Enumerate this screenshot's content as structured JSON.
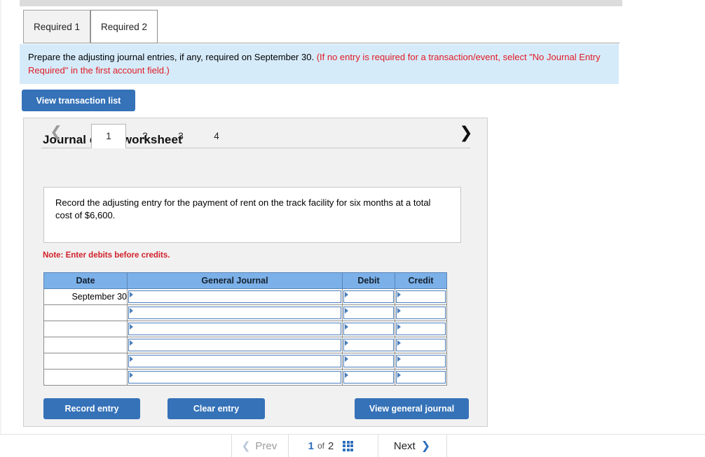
{
  "requirement_tabs": [
    {
      "label": "Required 1",
      "active": false
    },
    {
      "label": "Required 2",
      "active": true
    }
  ],
  "instruction": {
    "black": "Prepare the adjusting journal entries, if any, required on September 30.",
    "red": "(If no entry is required for a transaction/event, select \"No Journal Entry Required\" in the first account field.)"
  },
  "toolbar": {
    "view_transaction_list": "View transaction list"
  },
  "worksheet": {
    "title": "Journal entry worksheet",
    "pager": {
      "prev_icon": "chevron-left-icon",
      "next_icon": "chevron-right-icon",
      "entries": [
        {
          "label": "1",
          "active": true
        },
        {
          "label": "2",
          "active": false
        },
        {
          "label": "3",
          "active": false
        },
        {
          "label": "4",
          "active": false
        }
      ]
    },
    "description": "Record the adjusting entry for the payment of rent on the track facility for six months at a total cost of $6,600.",
    "note": "Note: Enter debits before credits.",
    "table": {
      "headers": [
        "Date",
        "General Journal",
        "Debit",
        "Credit"
      ],
      "rows": [
        {
          "date": "September 30",
          "general_journal": "",
          "debit": "",
          "credit": ""
        },
        {
          "date": "",
          "general_journal": "",
          "debit": "",
          "credit": ""
        },
        {
          "date": "",
          "general_journal": "",
          "debit": "",
          "credit": ""
        },
        {
          "date": "",
          "general_journal": "",
          "debit": "",
          "credit": ""
        },
        {
          "date": "",
          "general_journal": "",
          "debit": "",
          "credit": ""
        },
        {
          "date": "",
          "general_journal": "",
          "debit": "",
          "credit": ""
        }
      ]
    },
    "actions": {
      "record_entry": "Record entry",
      "clear_entry": "Clear entry",
      "view_general_journal": "View general journal"
    }
  },
  "bottom_nav": {
    "prev": "Prev",
    "next": "Next",
    "current_page": "1",
    "of": "of",
    "total_pages": "2",
    "grid_icon": "grid-icon"
  },
  "colors": {
    "accent_blue": "#3572b8",
    "table_header_blue": "#7cb0e8",
    "field_border_blue": "#4a7ebb",
    "instruction_bg": "#d6ebfa",
    "alert_red": "#e01b23",
    "note_red": "#d1202a",
    "panel_gray": "#f1f1f1"
  }
}
